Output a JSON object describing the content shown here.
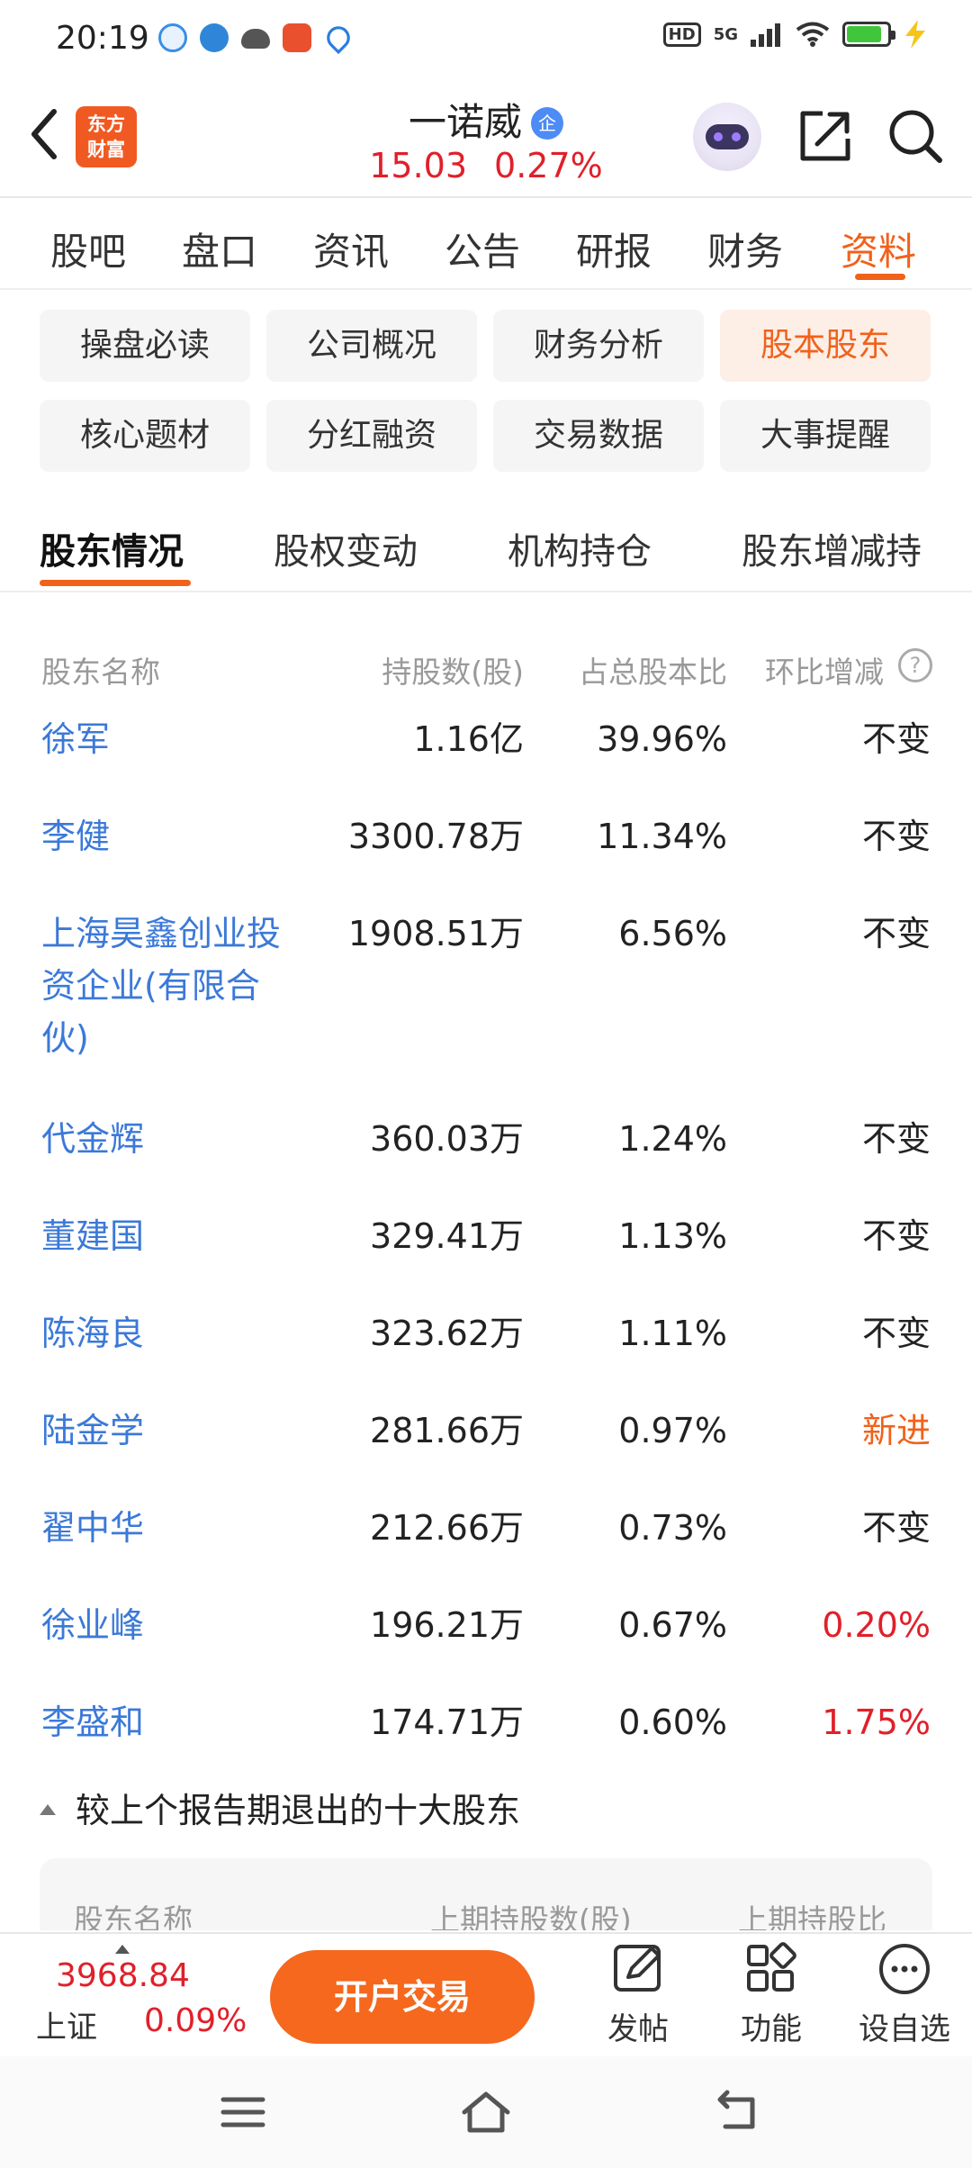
{
  "status_bar": {
    "time": "20:19",
    "hd": "HD",
    "network": "5G",
    "notification_icons": [
      "browser-icon",
      "edge-icon",
      "cloud-icon",
      "app-icon",
      "location-icon"
    ]
  },
  "header": {
    "logo_line1": "东方",
    "logo_line2": "财富",
    "stock_name": "一诺威",
    "badge": "企",
    "price": "15.03",
    "change_pct": "0.27%"
  },
  "main_tabs": [
    "股吧",
    "盘口",
    "资讯",
    "公告",
    "研报",
    "财务",
    "资料"
  ],
  "main_tab_active": "资料",
  "categories": [
    "操盘必读",
    "公司概况",
    "财务分析",
    "股本股东",
    "核心题材",
    "分红融资",
    "交易数据",
    "大事提醒"
  ],
  "category_active": "股本股东",
  "shareholder_tabs": [
    "股东情况",
    "股权变动",
    "机构持仓",
    "股东增减持"
  ],
  "shareholder_tab_active": "股东情况",
  "table": {
    "headers": [
      "股东名称",
      "持股数(股)",
      "占总股本比",
      "环比增减"
    ],
    "help": "?",
    "rows": [
      {
        "name": "徐军",
        "shares": "1.16亿",
        "ratio": "39.96%",
        "change": "不变"
      },
      {
        "name": "李健",
        "shares": "3300.78万",
        "ratio": "11.34%",
        "change": "不变"
      },
      {
        "name_lines": [
          "上海昊鑫创业投",
          "资企业(有限合",
          "伙)"
        ],
        "shares": "1908.51万",
        "ratio": "6.56%",
        "change": "不变"
      },
      {
        "name": "代金辉",
        "shares": "360.03万",
        "ratio": "1.24%",
        "change": "不变"
      },
      {
        "name": "董建国",
        "shares": "329.41万",
        "ratio": "1.13%",
        "change": "不变"
      },
      {
        "name": "陈海良",
        "shares": "323.62万",
        "ratio": "1.11%",
        "change": "不变"
      },
      {
        "name": "陆金学",
        "shares": "281.66万",
        "ratio": "0.97%",
        "change": "新进"
      },
      {
        "name": "翟中华",
        "shares": "212.66万",
        "ratio": "0.73%",
        "change": "不变"
      },
      {
        "name": "徐业峰",
        "shares": "196.21万",
        "ratio": "0.67%",
        "change": "0.20%"
      },
      {
        "name": "李盛和",
        "shares": "174.71万",
        "ratio": "0.60%",
        "change": "1.75%"
      }
    ]
  },
  "exited_section": {
    "title": "较上个报告期退出的十大股东",
    "headers": [
      "股东名称",
      "上期持股数(股)",
      "上期持股比"
    ]
  },
  "bottom_bar": {
    "index_value": "3968.84",
    "index_name": "上证",
    "index_pct": "0.09%",
    "trade_button": "开户交易",
    "tools": [
      "发帖",
      "功能",
      "设自选"
    ]
  },
  "colors": {
    "accent": "#f0621b",
    "up_red": "#e0202a",
    "link_blue": "#3b79d8"
  }
}
